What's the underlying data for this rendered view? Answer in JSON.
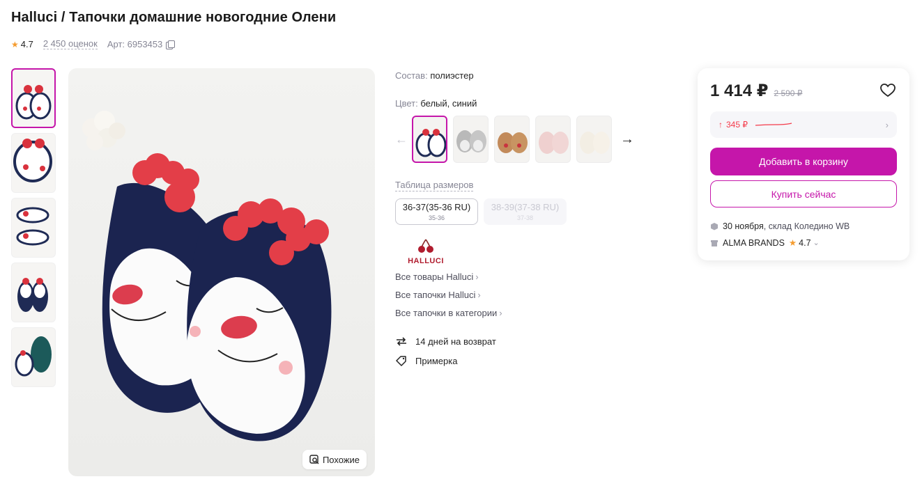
{
  "product": {
    "title": "Halluci / Тапочки домашние новогодние Олени",
    "rating": "4.7",
    "reviews": "2 450 оценок",
    "article": "Арт: 6953453"
  },
  "main_image": {
    "similar_label": "Похожие"
  },
  "details": {
    "composition_label": "Состав:",
    "composition_value": "полиэстер",
    "color_label": "Цвет:",
    "color_value": "белый, синий",
    "size_table_label": "Таблица размеров",
    "sizes": [
      {
        "label": "36-37(35-36 RU)",
        "sub": "35-36",
        "available": true
      },
      {
        "label": "38-39(37-38 RU)",
        "sub": "37-38",
        "available": false
      }
    ],
    "brand_name": "HALLUCI",
    "links": [
      "Все товары Halluci",
      "Все тапочки Halluci",
      "Все тапочки в категории"
    ],
    "perks": [
      "14 дней на возврат",
      "Примерка"
    ]
  },
  "purchase": {
    "price": "1 414 ₽",
    "old_price": "2 590 ₽",
    "discount_amount": "345 ₽",
    "add_to_cart": "Добавить в корзину",
    "buy_now": "Купить сейчас",
    "delivery_date": "30 ноября",
    "delivery_warehouse": ", склад Коледино WB",
    "seller_name": "ALMA BRANDS",
    "seller_rating": "4.7"
  },
  "colors": {
    "accent": "#c516aa",
    "star": "#f59c2f",
    "discount": "#f43a4a"
  }
}
